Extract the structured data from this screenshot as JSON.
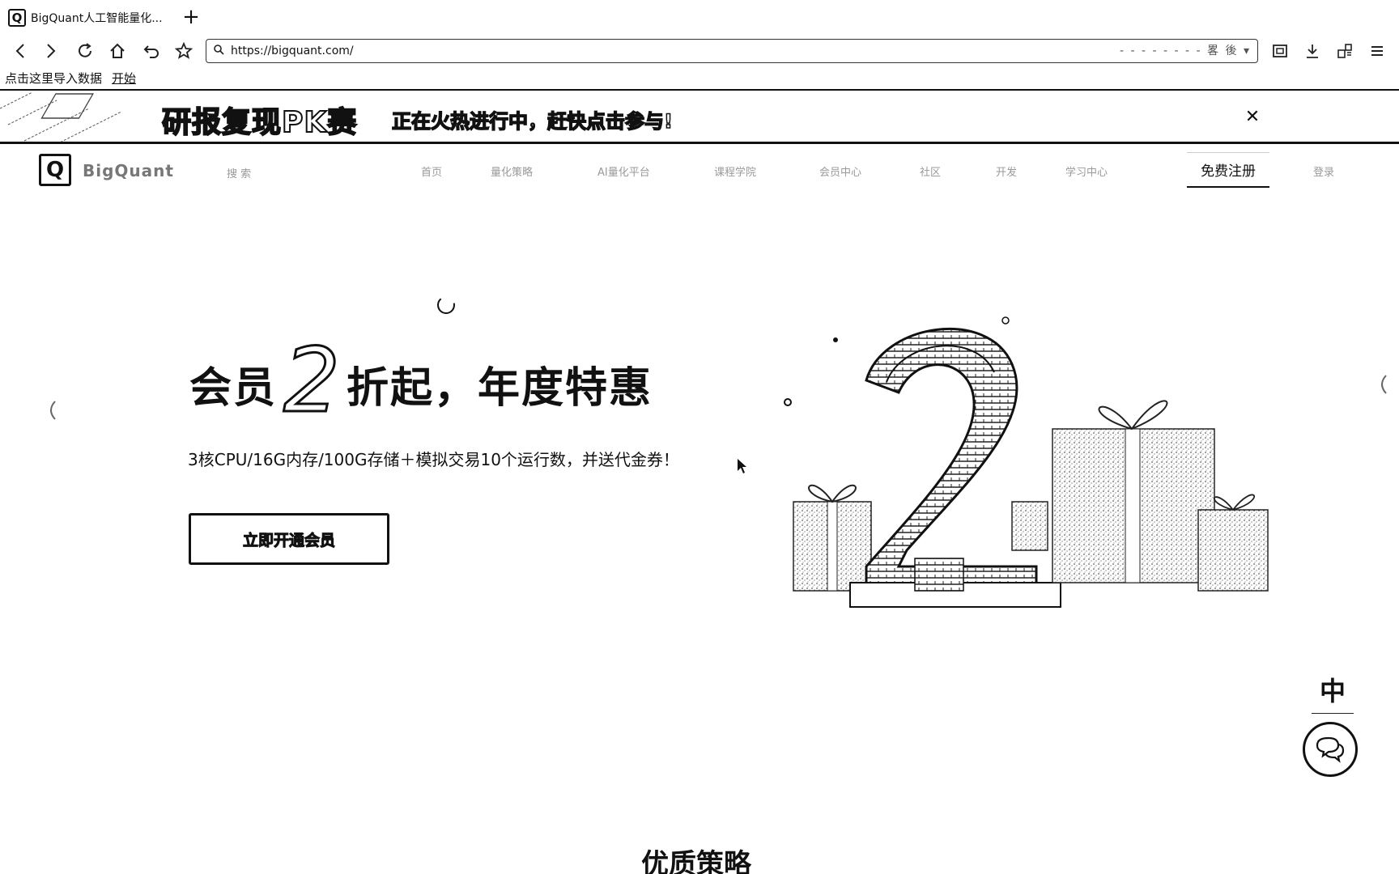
{
  "browser": {
    "tab": {
      "title": "BigQuant人工智能量化...",
      "favicon": "Q"
    },
    "new_tab": "+",
    "url": "https://bigquant.com/",
    "url_right_hint": "- - - - -    - - - 畧 後 ▾",
    "bookmarks": {
      "item": "点击这里导入数据",
      "link": "开始"
    }
  },
  "promo": {
    "title": "研报复现PK赛",
    "subtitle": "正在火热进行中，赶快点击参与!",
    "close": "✕"
  },
  "header": {
    "logo_mark": "Q",
    "logo_text": "BigQuant",
    "search_hint": "搜 索",
    "nav": [
      "首页",
      "量化策略",
      "AI量化平台",
      "课程学院",
      "会员中心",
      "社区",
      "开发",
      "学习中心"
    ],
    "register": "免费注册",
    "login": "登录"
  },
  "hero": {
    "pre": "会员",
    "num": "2",
    "post": "折起，年度特惠",
    "subtitle": "3核CPU/16G内存/100G存储＋模拟交易10个运行数，并送代金券！",
    "cta": "立即开通会员"
  },
  "section": {
    "title": "优质策略"
  },
  "widgets": {
    "lang": "中"
  },
  "icons": {
    "back": "chevron-left-icon",
    "forward": "chevron-right-icon",
    "reload": "reload-icon",
    "home": "home-icon",
    "undo": "undo-icon",
    "star": "star-icon",
    "download": "download-icon",
    "menu": "menu-icon",
    "chat": "chat-icon"
  }
}
